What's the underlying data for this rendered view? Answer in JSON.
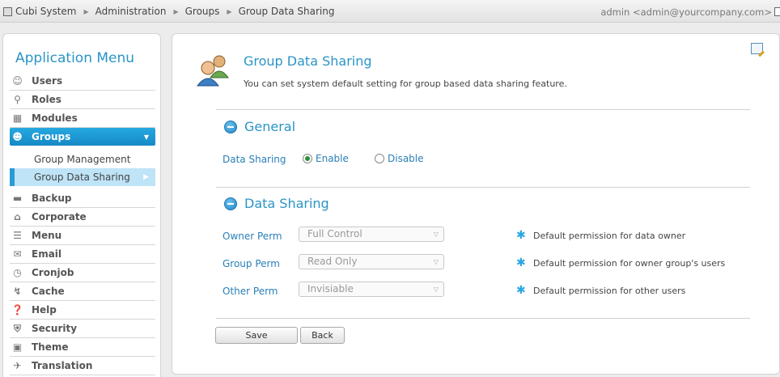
{
  "breadcrumb": [
    "Cubi System",
    "Administration",
    "Groups",
    "Group Data Sharing"
  ],
  "user": "admin <admin@yourcompany.com>",
  "sidebar": {
    "title": "Application Menu",
    "items": [
      {
        "label": "Users",
        "icon": "users-icon"
      },
      {
        "label": "Roles",
        "icon": "key-icon"
      },
      {
        "label": "Modules",
        "icon": "modules-icon"
      },
      {
        "label": "Groups",
        "icon": "groups-icon"
      },
      {
        "label": "Backup",
        "icon": "backup-icon"
      },
      {
        "label": "Corporate",
        "icon": "corporate-icon"
      },
      {
        "label": "Menu",
        "icon": "menu-icon"
      },
      {
        "label": "Email",
        "icon": "email-icon"
      },
      {
        "label": "Cronjob",
        "icon": "clock-icon"
      },
      {
        "label": "Cache",
        "icon": "lightning-icon"
      },
      {
        "label": "Help",
        "icon": "help-icon"
      },
      {
        "label": "Security",
        "icon": "shield-icon"
      },
      {
        "label": "Theme",
        "icon": "theme-icon"
      },
      {
        "label": "Translation",
        "icon": "translation-icon"
      }
    ],
    "groups_sub": [
      "Group Management",
      "Group Data Sharing"
    ]
  },
  "main": {
    "title": "Group Data Sharing",
    "description": "You can set system default setting for group based data sharing feature.",
    "general": {
      "heading": "General",
      "label": "Data Sharing",
      "enable": "Enable",
      "disable": "Disable",
      "selected": "Enable"
    },
    "data_sharing": {
      "heading": "Data Sharing",
      "rows": [
        {
          "label": "Owner Perm",
          "value": "Full Control",
          "hint": "Default permission for data owner"
        },
        {
          "label": "Group Perm",
          "value": "Read Only",
          "hint": "Default permission for owner group's users"
        },
        {
          "label": "Other Perm",
          "value": "Invisiable",
          "hint": "Default permission for other users"
        }
      ]
    },
    "buttons": {
      "save": "Save",
      "back": "Back"
    }
  },
  "colors": {
    "accent": "#2a95c6",
    "active_menu": "#1b95d2",
    "active_sub": "#bfe3f7"
  }
}
